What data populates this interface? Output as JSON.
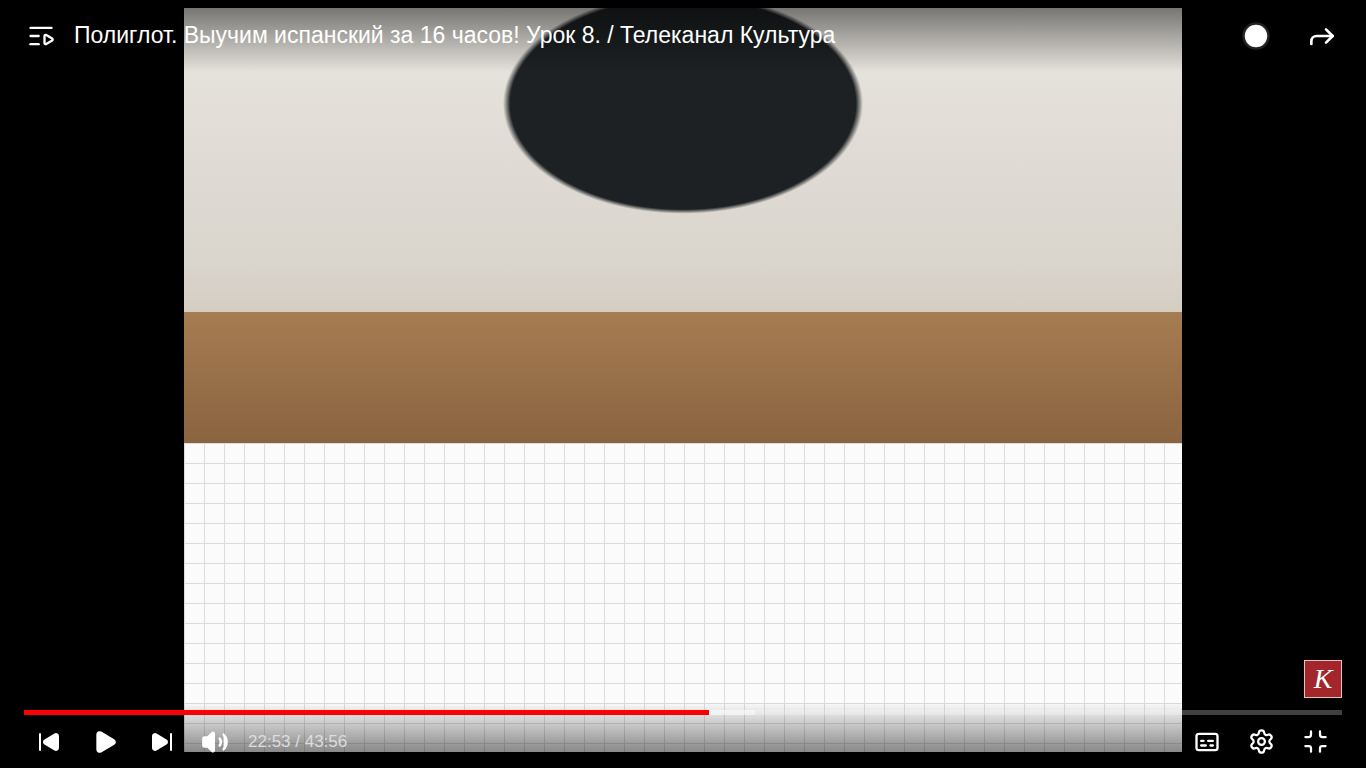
{
  "window": {
    "title": "Полиглот. Выучим испанский за 16 часов! Урок 8. / Телеканал Культура"
  },
  "player": {
    "time": "22:53 / 43:56",
    "level": 0.52,
    "buffered": 0.555,
    "playing": false
  },
  "watermark": {
    "text": "К"
  }
}
